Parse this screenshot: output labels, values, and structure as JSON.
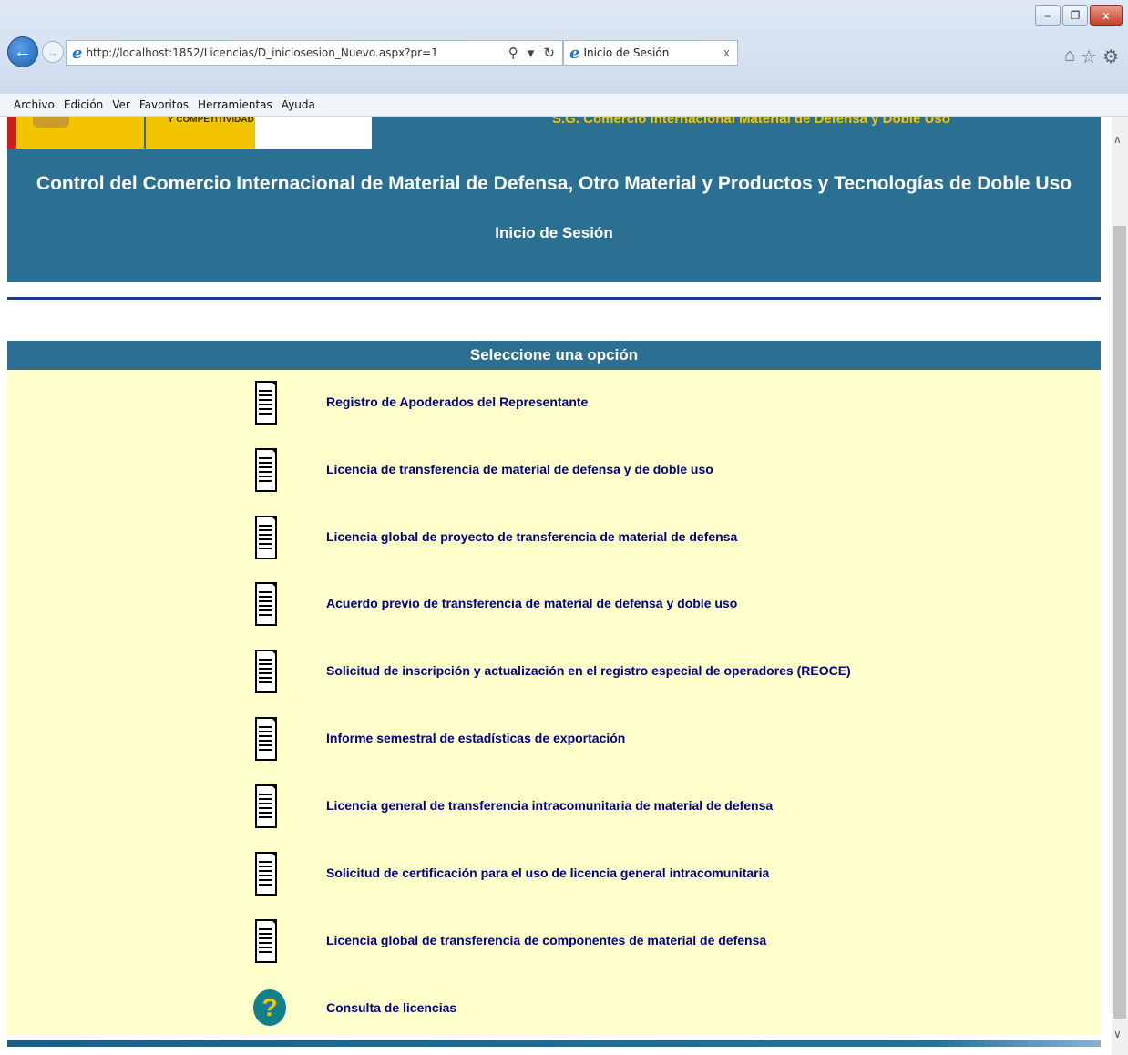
{
  "browser": {
    "url": "http://localhost:1852/Licencias/D_iniciosesion_Nuevo.aspx?pr=1",
    "tab_title": "Inicio de Sesión",
    "tab_close": "x",
    "search_icon": "search-icon",
    "refresh_icon": "refresh-icon",
    "menu": [
      "Archivo",
      "Edición",
      "Ver",
      "Favoritos",
      "Herramientas",
      "Ayuda"
    ]
  },
  "header": {
    "ministry_text": "Y COMPETITIVIDAD",
    "sg_text": "S.G. Comercio Internacional Material de Defensa y Doble Uso",
    "title": "Control del Comercio Internacional de Material de Defensa, Otro Material y Productos y Tecnologías de Doble Uso",
    "subtitle": "Inicio de Sesión"
  },
  "panel": {
    "heading": "Seleccione una opción",
    "options": [
      {
        "label": "Registro de Apoderados del Representante",
        "icon": "document-icon"
      },
      {
        "label": "Licencia de transferencia de material de defensa y de doble uso",
        "icon": "document-icon"
      },
      {
        "label": "Licencia global de proyecto de transferencia de material de defensa",
        "icon": "document-icon"
      },
      {
        "label": "Acuerdo previo de transferencia de material de defensa y doble uso",
        "icon": "document-icon"
      },
      {
        "label": "Solicitud de inscripción y actualización en el registro especial de operadores (REOCE)",
        "icon": "document-icon"
      },
      {
        "label": "Informe semestral de estadísticas de exportación",
        "icon": "document-icon"
      },
      {
        "label": "Licencia general de transferencia intracomunitaria de material de defensa",
        "icon": "document-icon"
      },
      {
        "label": "Solicitud de certificación para el uso de licencia general intracomunitaria",
        "icon": "document-icon"
      },
      {
        "label": "Licencia global de transferencia de componentes de material de defensa",
        "icon": "document-icon"
      },
      {
        "label": "Consulta de licencias",
        "icon": "question-icon",
        "glyph": "?"
      }
    ]
  },
  "colors": {
    "header_bg": "#2b7093",
    "panel_bg": "#ffffcc",
    "link": "#000080",
    "gold": "#f3c400"
  }
}
